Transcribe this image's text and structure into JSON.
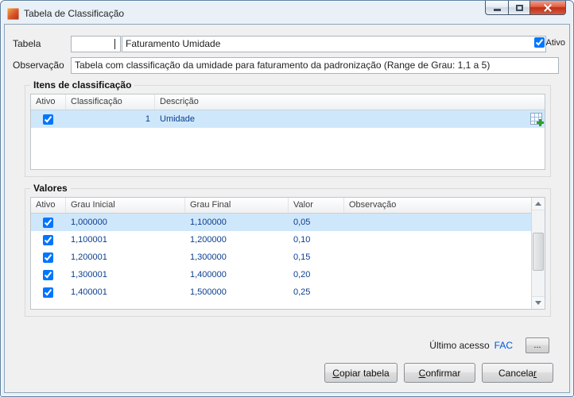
{
  "window": {
    "title": "Tabela de Classificação"
  },
  "colors": {
    "selection_blue": "#cfe7fa",
    "grid_text_navy": "#0b3e8f",
    "link_blue": "#0057d8",
    "close_button_red": "#bf3019",
    "dialog_background": "#f0f0f0"
  },
  "form": {
    "tabela_label": "Tabela",
    "tabela_code_value": "",
    "tabela_name_value": "Faturamento Umidade",
    "ativo_label": "Ativo",
    "ativo_checked": true,
    "observacao_label": "Observação",
    "observacao_value": "Tabela com classificação da umidade para faturamento da padronização (Range de Grau: 1,1 a 5)"
  },
  "itens": {
    "title": "Itens de classificação",
    "columns": {
      "ativo": "Ativo",
      "classificacao": "Classificação",
      "descricao": "Descrição"
    },
    "rows": [
      {
        "ativo": true,
        "classificacao": "1",
        "descricao": "Umidade"
      }
    ]
  },
  "valores": {
    "title": "Valores",
    "columns": {
      "ativo": "Ativo",
      "grau_inicial": "Grau Inicial",
      "grau_final": "Grau Final",
      "valor": "Valor",
      "observacao": "Observação"
    },
    "rows": [
      {
        "ativo": true,
        "grau_inicial": "1,000000",
        "grau_final": "1,100000",
        "valor": "0,05",
        "observacao": ""
      },
      {
        "ativo": true,
        "grau_inicial": "1,100001",
        "grau_final": "1,200000",
        "valor": "0,10",
        "observacao": ""
      },
      {
        "ativo": true,
        "grau_inicial": "1,200001",
        "grau_final": "1,300000",
        "valor": "0,15",
        "observacao": ""
      },
      {
        "ativo": true,
        "grau_inicial": "1,300001",
        "grau_final": "1,400000",
        "valor": "0,20",
        "observacao": ""
      },
      {
        "ativo": true,
        "grau_inicial": "1,400001",
        "grau_final": "1,500000",
        "valor": "0,25",
        "observacao": ""
      }
    ]
  },
  "footer": {
    "ultimo_acesso_label": "Último acesso",
    "ultimo_acesso_value": "FAC",
    "browse_button_label": "...",
    "copiar": {
      "pre": "",
      "key": "C",
      "post": "opiar tabela"
    },
    "confirmar": {
      "pre": "",
      "key": "C",
      "post": "onfirmar"
    },
    "cancelar": {
      "pre": "Cancela",
      "key": "r",
      "post": ""
    }
  }
}
